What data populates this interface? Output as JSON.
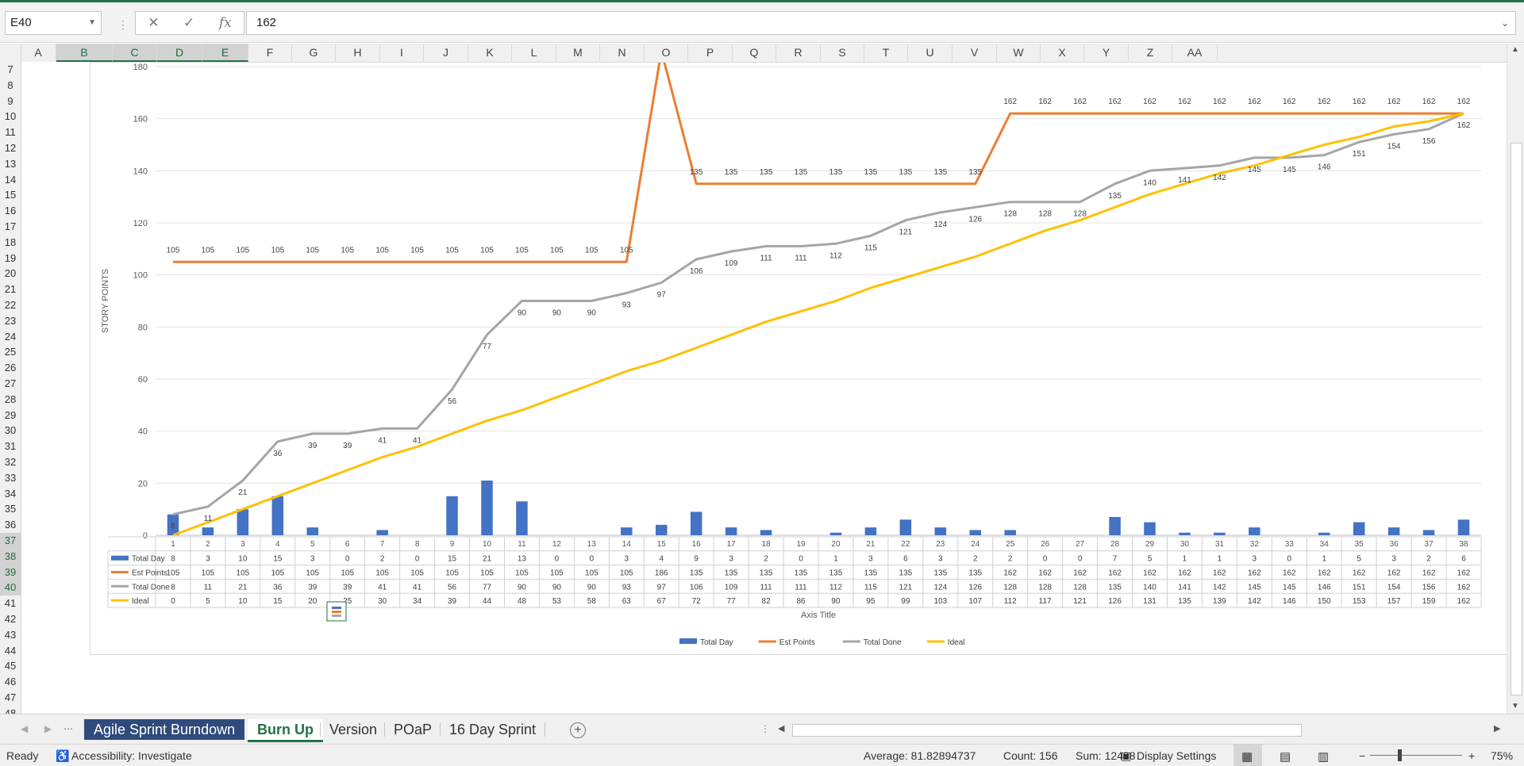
{
  "formula_bar": {
    "name_box": "E40",
    "formula": "162"
  },
  "columns": [
    "A",
    "B",
    "C",
    "D",
    "E",
    "F",
    "G",
    "H",
    "I",
    "J",
    "K",
    "L",
    "M",
    "N",
    "O",
    "P",
    "Q",
    "R",
    "S",
    "T",
    "U",
    "V",
    "W",
    "X",
    "Y",
    "Z",
    "AA"
  ],
  "rows": [
    "7",
    "8",
    "9",
    "10",
    "11",
    "12",
    "13",
    "14",
    "15",
    "16",
    "17",
    "18",
    "19",
    "20",
    "21",
    "22",
    "23",
    "24",
    "25",
    "26",
    "27",
    "28",
    "29",
    "30",
    "31",
    "32",
    "33",
    "34",
    "35",
    "36",
    "37",
    "38",
    "39",
    "40",
    "41",
    "42",
    "43",
    "44",
    "45",
    "46",
    "47",
    "48"
  ],
  "chart_data": {
    "type": "line",
    "categories": [
      "1",
      "2",
      "3",
      "4",
      "5",
      "6",
      "7",
      "8",
      "9",
      "10",
      "11",
      "12",
      "13",
      "14",
      "15",
      "16",
      "17",
      "18",
      "19",
      "20",
      "21",
      "22",
      "23",
      "24",
      "25",
      "26",
      "27",
      "28",
      "29",
      "30",
      "31",
      "32",
      "33",
      "34",
      "35",
      "36",
      "37",
      "38"
    ],
    "series": [
      {
        "name": "Total Day",
        "kind": "bar",
        "color": "#4472c4",
        "values": [
          8,
          3,
          10,
          15,
          3,
          0,
          2,
          0,
          15,
          21,
          13,
          0,
          0,
          3,
          4,
          9,
          3,
          2,
          0,
          1,
          3,
          6,
          3,
          2,
          2,
          0,
          0,
          7,
          5,
          1,
          1,
          3,
          0,
          1,
          5,
          3,
          2,
          6
        ]
      },
      {
        "name": "Est Points",
        "kind": "line",
        "color": "#ed7d31",
        "values": [
          105,
          105,
          105,
          105,
          105,
          105,
          105,
          105,
          105,
          105,
          105,
          105,
          105,
          105,
          186,
          135,
          135,
          135,
          135,
          135,
          135,
          135,
          135,
          135,
          162,
          162,
          162,
          162,
          162,
          162,
          162,
          162,
          162,
          162,
          162,
          162,
          162,
          162
        ]
      },
      {
        "name": "Total Done",
        "kind": "line",
        "color": "#a5a5a5",
        "values": [
          8,
          11,
          21,
          36,
          39,
          39,
          41,
          41,
          56,
          77,
          90,
          90,
          90,
          93,
          97,
          106,
          109,
          111,
          111,
          112,
          115,
          121,
          124,
          126,
          128,
          128,
          128,
          135,
          140,
          141,
          142,
          145,
          145,
          146,
          151,
          154,
          156,
          162
        ]
      },
      {
        "name": "Ideal",
        "kind": "line",
        "color": "#ffc000",
        "values": [
          0,
          5,
          10,
          15,
          20,
          25,
          30,
          34,
          39,
          44,
          48,
          53,
          58,
          63,
          67,
          72,
          77,
          82,
          86,
          90,
          95,
          99,
          103,
          107,
          112,
          117,
          121,
          126,
          131,
          135,
          139,
          142,
          146,
          150,
          153,
          157,
          159,
          162
        ]
      }
    ],
    "ylabel": "STORY POINTS",
    "xlabel": "Axis Title",
    "ylim": [
      0,
      180
    ],
    "yticks": [
      "0",
      "20",
      "40",
      "60",
      "80",
      "100",
      "120",
      "140",
      "160",
      "180"
    ],
    "grid": true,
    "legend": "bottom",
    "data_table": true
  },
  "sheet_tabs": {
    "tabs": [
      {
        "label": "Agile Sprint Burndown",
        "style": "dark"
      },
      {
        "label": "Burn Up",
        "style": "active"
      },
      {
        "label": "Version",
        "style": "normal"
      },
      {
        "label": "POaP",
        "style": "normal"
      },
      {
        "label": "16 Day Sprint",
        "style": "normal"
      }
    ]
  },
  "status_bar": {
    "ready": "Ready",
    "accessibility": "Accessibility: Investigate",
    "average": "Average: 81.82894737",
    "count": "Count: 156",
    "sum": "Sum: 12438",
    "display_settings": "Display Settings",
    "zoom": "75%"
  }
}
